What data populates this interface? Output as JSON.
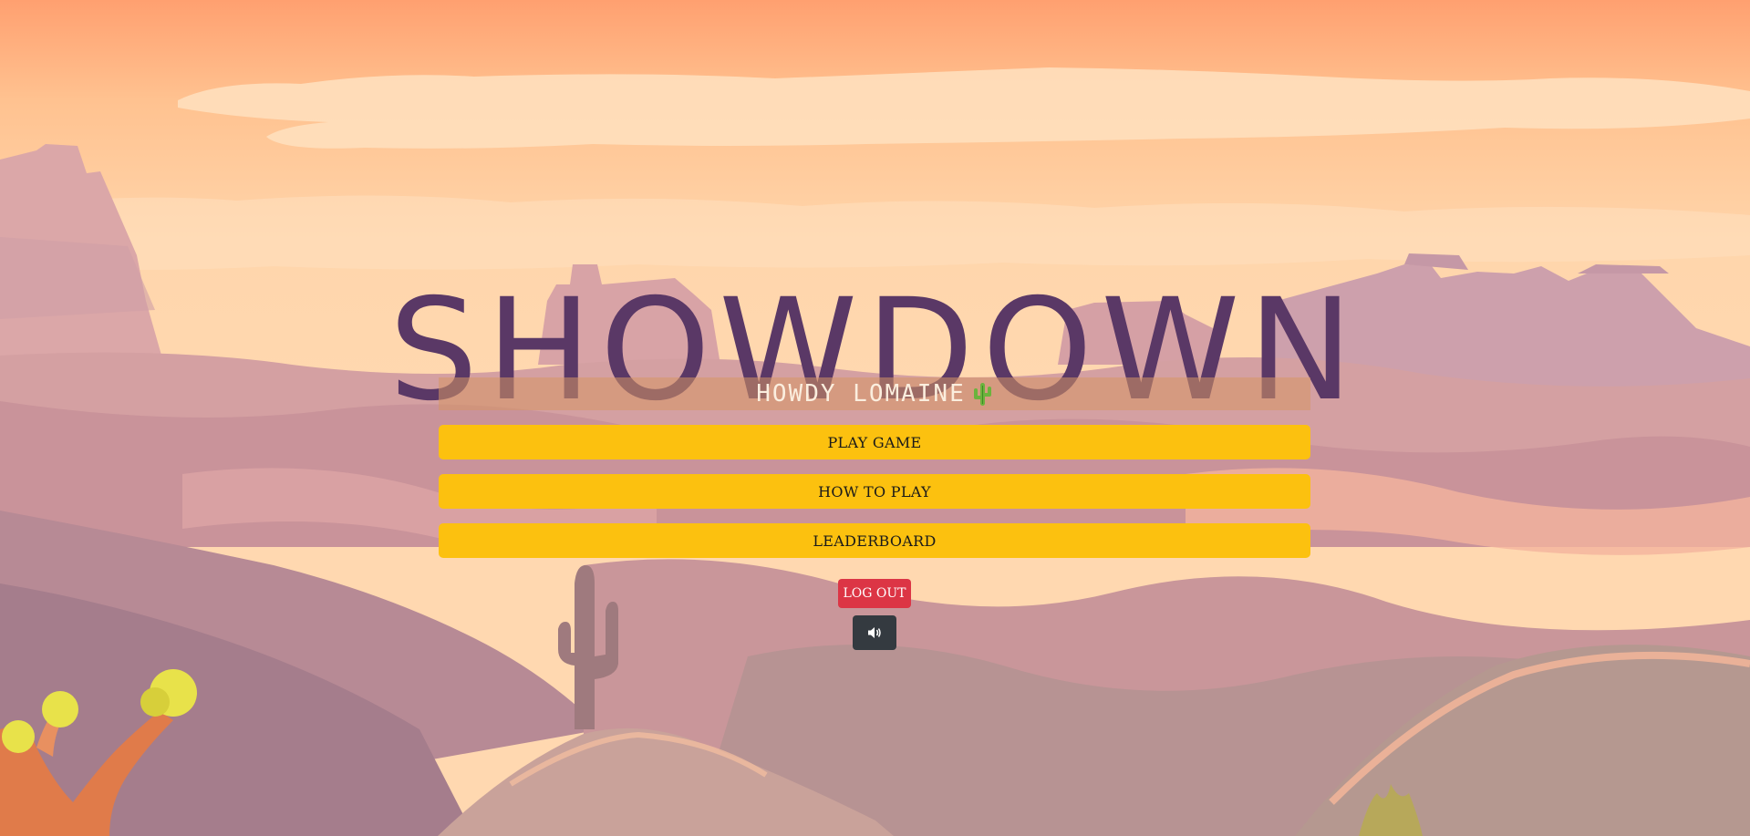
{
  "game": {
    "title": "SHOWDOWN",
    "greeting": "HOWDY LOMAINE",
    "greeting_icon": "cactus-icon"
  },
  "menu": {
    "play_label": "PLAY GAME",
    "how_to_play_label": "HOW TO PLAY",
    "leaderboard_label": "LEADERBOARD",
    "logout_label": "LOG OUT",
    "sound_icon": "speaker-icon"
  },
  "colors": {
    "title": "#5a3866",
    "menu_button": "#fcc10f",
    "logout_button": "#dc3545",
    "sound_button": "#343a40",
    "greeting_bar": "#d69664"
  }
}
